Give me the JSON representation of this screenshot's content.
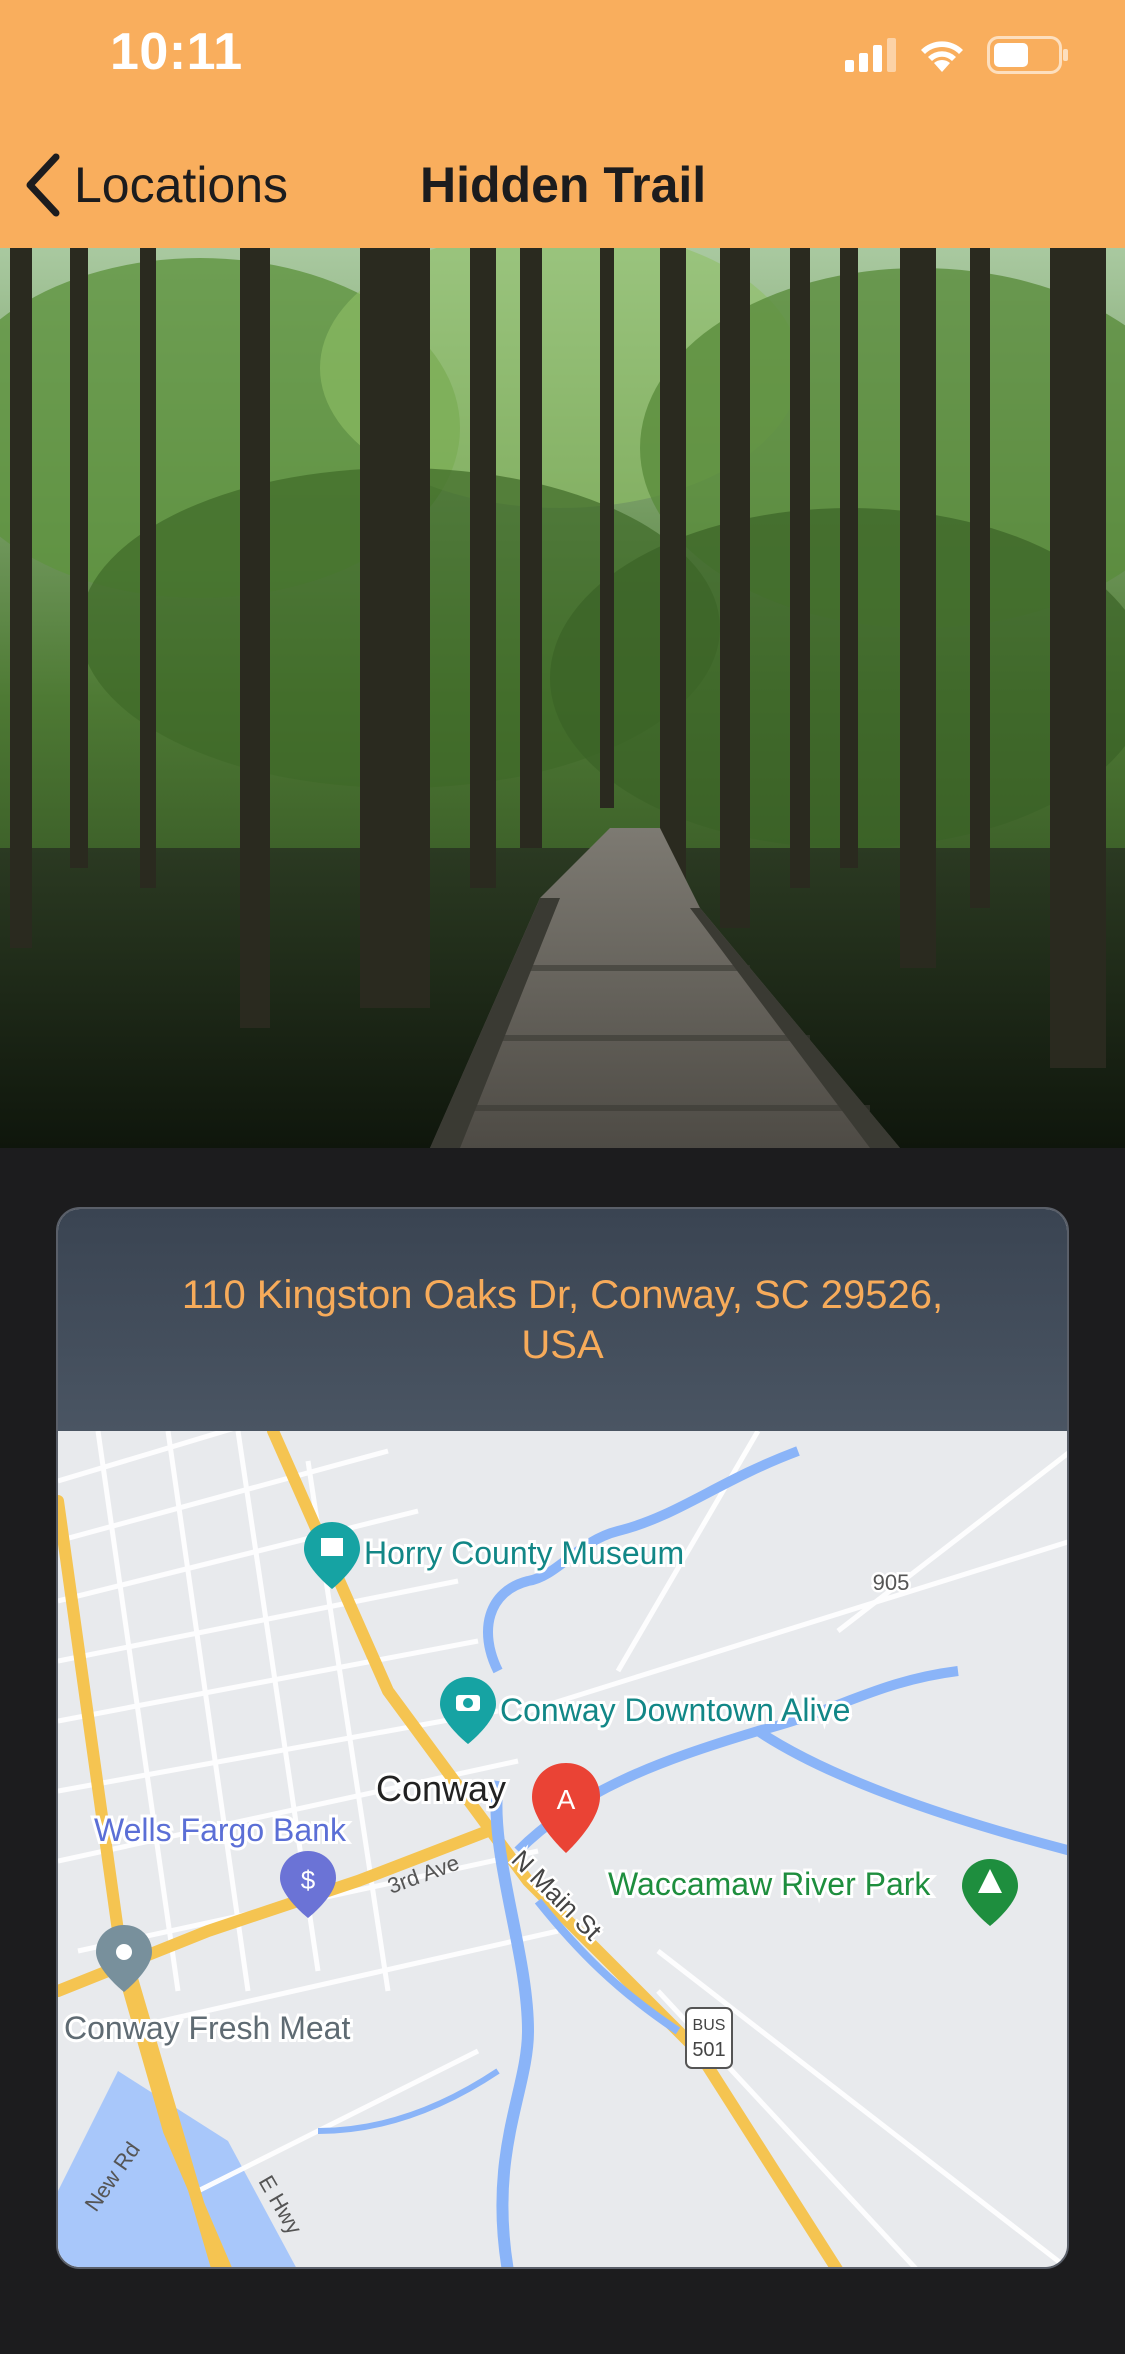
{
  "status_bar": {
    "time": "10:11"
  },
  "nav": {
    "back_label": "Locations",
    "title": "Hidden Trail"
  },
  "location": {
    "address": "110 Kingston Oaks Dr, Conway, SC 29526, USA"
  },
  "map": {
    "marker_label": "A",
    "places": {
      "museum": "Horry County Museum",
      "downtown": "Conway Downtown Alive",
      "city": "Conway",
      "bank": "Wells Fargo Bank",
      "park": "Waccamaw River Park",
      "meat": "Conway Fresh Meat"
    },
    "streets": {
      "main": "N Main St",
      "third": "3rd Ave",
      "newrd": "New Rd",
      "hwy": "E Hwy"
    },
    "shields": {
      "route905": "905",
      "bus": "BUS",
      "route501": "501"
    }
  },
  "colors": {
    "accent": "#f9ae5d",
    "background": "#1c1c1e",
    "address_text": "#f7ab5a"
  }
}
